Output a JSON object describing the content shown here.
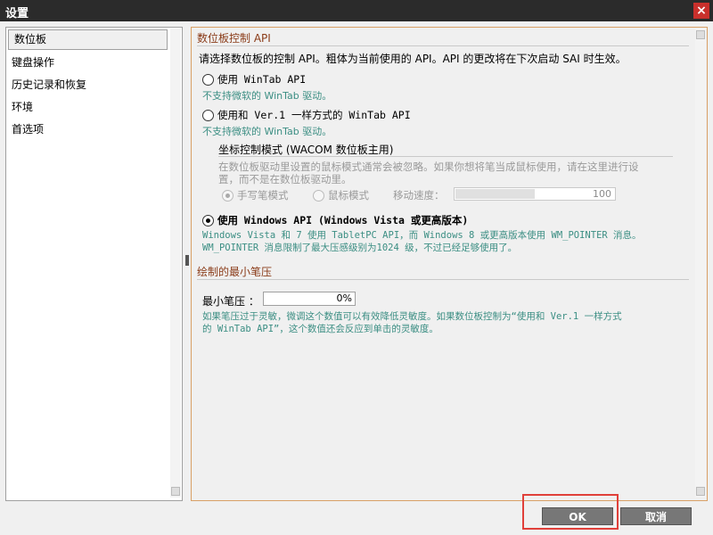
{
  "window": {
    "title": "设置",
    "close_glyph": "×"
  },
  "sidebar": {
    "items": [
      {
        "label": "数位板",
        "selected": true
      },
      {
        "label": "键盘操作"
      },
      {
        "label": "历史记录和恢复"
      },
      {
        "label": "环境"
      },
      {
        "label": "首选项"
      }
    ]
  },
  "tablet": {
    "heading": "数位板控制 API",
    "description": "请选择数位板的控制 API。粗体为当前使用的 API。API 的更改将在下次启动 SAI 时生效。",
    "options": [
      {
        "label": "使用 WinTab API",
        "note": "不支持微软的 WinTab 驱动。",
        "checked": false
      },
      {
        "label": "使用和 Ver.1 一样方式的 WinTab API",
        "note": "不支持微软的 WinTab 驱动。",
        "checked": false
      },
      {
        "label": "使用 Windows API (Windows Vista 或更高版本)",
        "note_line1": "Windows Vista 和 7 使用 TabletPC API，而 Windows 8 或更高版本使用 WM_POINTER 消息。",
        "note_line2": "WM_POINTER 消息限制了最大压感级别为1024 级，不过已经足够使用了。",
        "checked": true
      }
    ],
    "coord_group": {
      "title": "坐标控制模式 (WACOM 数位板主用)",
      "desc_line1": "在数位板驱动里设置的鼠标模式通常会被忽略。如果你想将笔当成鼠标使用，请在这里进行设",
      "desc_line2": "置，而不是在数位板驱动里。",
      "pen_mode": "手写笔模式",
      "mouse_mode": "鼠标模式",
      "speed_label": "移动速度：",
      "speed_value": "100",
      "speed_fill_fraction": 0.5
    }
  },
  "pressure": {
    "heading": "绘制的最小笔压",
    "label": "最小笔压 ：",
    "value": "0%",
    "note_line1": "如果笔压过于灵敏，微调这个数值可以有效降低灵敏度。如果数位板控制为“使用和 Ver.1 一样方式",
    "note_line2": "的 WinTab API”，这个数值还会反应到单击的灵敏度。"
  },
  "buttons": {
    "ok": "OK",
    "cancel": "取消"
  },
  "colors": {
    "accent_heading": "#8a3b18",
    "note_text": "#3b8e83",
    "highlight": "#e0403a"
  }
}
